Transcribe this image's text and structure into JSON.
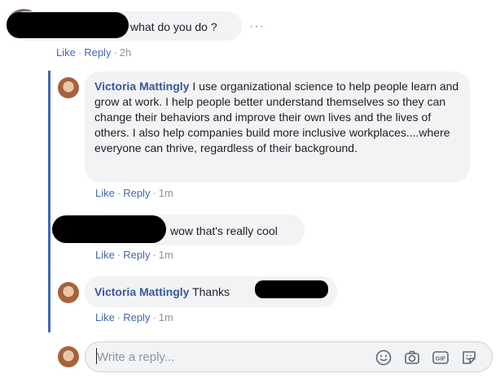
{
  "comment1": {
    "text": "what do you do ?",
    "more_icon": "ellipsis-icon",
    "actions": {
      "like": "Like",
      "reply": "Reply",
      "time": "2h"
    }
  },
  "replies": [
    {
      "author": "Victoria Mattingly",
      "text": "I use organizational science to help people learn and grow at work. I help people better understand themselves so they can change their behaviors and improve their own lives and the lives of others. I also help companies build more inclusive workplaces....where everyone can thrive, regardless of their background.",
      "actions": {
        "like": "Like",
        "reply": "Reply",
        "time": "1m"
      }
    },
    {
      "text": "wow that's really cool",
      "actions": {
        "like": "Like",
        "reply": "Reply",
        "time": "1m"
      }
    },
    {
      "author": "Victoria Mattingly",
      "text": "Thanks",
      "actions": {
        "like": "Like",
        "reply": "Reply",
        "time": "1m"
      }
    }
  ],
  "reply_box": {
    "placeholder": "Write a reply...",
    "icons": [
      "emoji-icon",
      "camera-icon",
      "gif-icon",
      "sticker-icon"
    ]
  },
  "colors": {
    "link": "#4267b2",
    "author": "#385898",
    "bubble": "#f2f3f5",
    "thread_line": "#4267b2",
    "meta": "#8d949e"
  }
}
